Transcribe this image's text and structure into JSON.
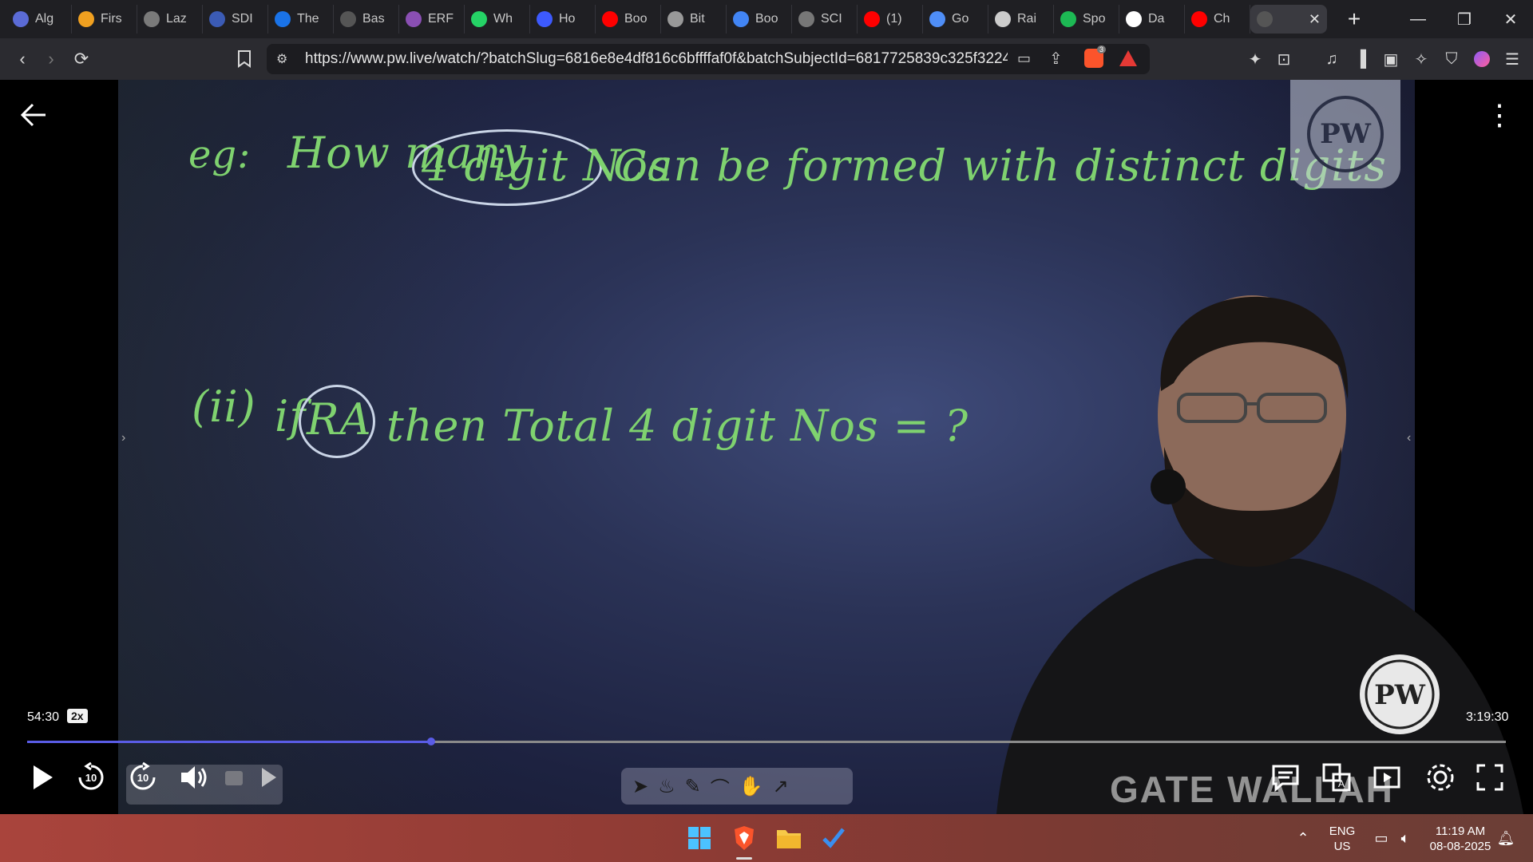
{
  "tabs": [
    {
      "label": "Alg",
      "icon": "globe-icon",
      "color": "#5b6bd6"
    },
    {
      "label": "Firs",
      "icon": "coding-icon",
      "color": "#f0a020"
    },
    {
      "label": "Laz",
      "icon": "globe-icon",
      "color": "#7a7a7a"
    },
    {
      "label": "SDI",
      "icon": "doc-icon",
      "color": "#3b5bb5"
    },
    {
      "label": "The",
      "icon": "w3-icon",
      "color": "#1a73e8"
    },
    {
      "label": "Bas",
      "icon": "doc-icon",
      "color": "#555"
    },
    {
      "label": "ERF",
      "icon": "brain-icon",
      "color": "#8a4fb3"
    },
    {
      "label": "Wh",
      "icon": "whatsapp-icon",
      "color": "#25d366"
    },
    {
      "label": "Ho",
      "icon": "bookmark-icon",
      "color": "#3d5afe"
    },
    {
      "label": "Boo",
      "icon": "youtube-icon",
      "color": "#ff0000"
    },
    {
      "label": "Bit",
      "icon": "bits-icon",
      "color": "#999"
    },
    {
      "label": "Boo",
      "icon": "google-icon",
      "color": "#4285f4"
    },
    {
      "label": "SCI",
      "icon": "globe-icon",
      "color": "#777"
    },
    {
      "label": "(1)",
      "icon": "youtube-icon",
      "color": "#ff0000"
    },
    {
      "label": "Go",
      "icon": "gemini-icon",
      "color": "#4f8ef7"
    },
    {
      "label": "Rai",
      "icon": "openai-icon",
      "color": "#cccccc"
    },
    {
      "label": "Spo",
      "icon": "spotify-icon",
      "color": "#1db954"
    },
    {
      "label": "Da",
      "icon": "wikipedia-icon",
      "color": "#ffffff"
    },
    {
      "label": "Ch",
      "icon": "youtube-icon",
      "color": "#ff0000"
    }
  ],
  "active_tab": {
    "label": "",
    "icon": "pw-icon",
    "close": "✕"
  },
  "new_tab": "+",
  "address": {
    "url": "https://www.pw.live/watch/?batchSlug=6816e8e4df816c6bffffaf0f&batchSubjectId=6817725839c325f3224e28d..."
  },
  "brave_badge": "3",
  "board": {
    "line1_prefix": "eg:",
    "line1_a": "How many",
    "line1_circled": "4 digit Nos",
    "line1_b": "Can be formed with distinct digits",
    "line2_prefix": "(ii)",
    "line2_a": "if",
    "line2_circled": "RA",
    "line2_b": "then Total 4 digit Nos = ?"
  },
  "logo_text": "PW",
  "player": {
    "current_time": "54:30",
    "speed": "2x",
    "duration": "3:19:30",
    "progress_fraction": 0.273,
    "rewind_label": "10",
    "forward_label": "10"
  },
  "watermark": "GATE WALLAH",
  "taskbar": {
    "lang_line1": "ENG",
    "lang_line2": "US",
    "time": "11:19 AM",
    "date": "08-08-2025"
  }
}
